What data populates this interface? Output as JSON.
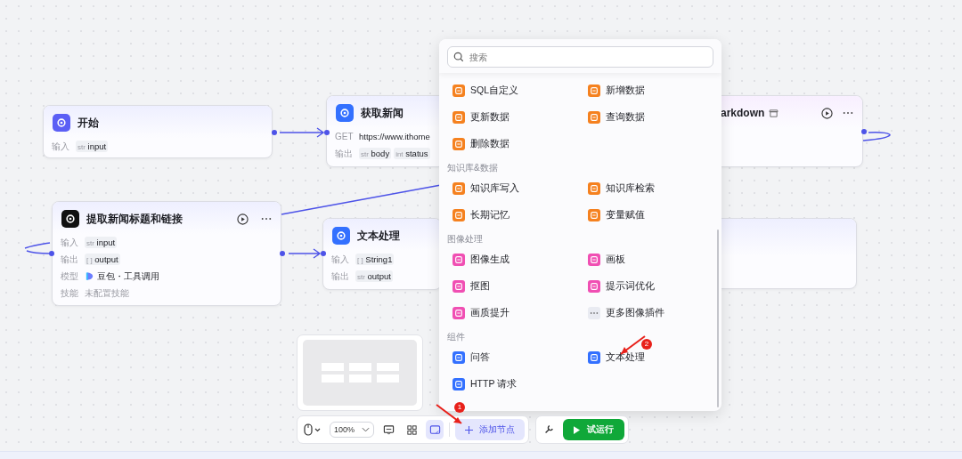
{
  "nodes": [
    {
      "title": "开始",
      "color": "#5b5ff5",
      "has_actions": false,
      "rows": [
        {
          "label": "输入",
          "kind": "tags",
          "tags": [
            {
              "type": "str",
              "name": "input"
            }
          ]
        }
      ]
    },
    {
      "title": "获取新闻",
      "color": "#3370ff",
      "has_actions": false,
      "rows": [
        {
          "label": "GET",
          "kind": "text",
          "value": "https://www.ithome"
        },
        {
          "label": "输出",
          "kind": "tags",
          "tags": [
            {
              "type": "str",
              "name": "body"
            },
            {
              "type": "int",
              "name": "status"
            }
          ]
        }
      ]
    },
    {
      "title": "arkdown",
      "has_actions": true
    },
    {
      "title": "提取新闻标题和链接",
      "color": "#111111",
      "has_actions": true,
      "rows": [
        {
          "label": "输入",
          "kind": "tags",
          "tags": [
            {
              "type": "str",
              "name": "input"
            }
          ]
        },
        {
          "label": "输出",
          "kind": "tags",
          "tags": [
            {
              "type": "[ ]",
              "name": "output"
            }
          ]
        },
        {
          "label": "模型",
          "kind": "model",
          "value": "豆包・工具调用"
        },
        {
          "label": "技能",
          "kind": "muted",
          "value": "未配置技能"
        }
      ]
    },
    {
      "title": "文本处理",
      "color": "#3370ff",
      "has_actions": false,
      "rows": [
        {
          "label": "输入",
          "kind": "tags",
          "tags": [
            {
              "type": "[ ]",
              "name": "String1"
            }
          ]
        },
        {
          "label": "输出",
          "kind": "tags",
          "tags": [
            {
              "type": "str",
              "name": "output"
            }
          ]
        }
      ]
    }
  ],
  "node_menu": {
    "search": {
      "placeholder": "搜索"
    },
    "sections": [
      {
        "items": [
          {
            "label": "SQL自定义",
            "kind": "node",
            "color": "#f5811f"
          },
          {
            "label": "新增数据",
            "kind": "node",
            "color": "#f5811f"
          },
          {
            "label": "更新数据",
            "kind": "node",
            "color": "#f5811f"
          },
          {
            "label": "查询数据",
            "kind": "node",
            "color": "#f5811f"
          },
          {
            "label": "删除数据",
            "kind": "node",
            "color": "#f5811f"
          }
        ]
      },
      {
        "title": "知识库&数据",
        "items": [
          {
            "label": "知识库写入",
            "kind": "node",
            "color": "#f5811f"
          },
          {
            "label": "知识库检索",
            "kind": "node",
            "color": "#f5811f"
          },
          {
            "label": "长期记忆",
            "kind": "node",
            "color": "#f5811f"
          },
          {
            "label": "变量赋值",
            "kind": "node",
            "color": "#f5811f"
          }
        ]
      },
      {
        "title": "图像处理",
        "items": [
          {
            "label": "图像生成",
            "kind": "node",
            "color": "#f04fb3"
          },
          {
            "label": "画板",
            "kind": "node",
            "color": "#f04fb3"
          },
          {
            "label": "抠图",
            "kind": "node",
            "color": "#f04fb3"
          },
          {
            "label": "提示词优化",
            "kind": "node",
            "color": "#f04fb3"
          },
          {
            "label": "画质提升",
            "kind": "node",
            "color": "#f04fb3"
          },
          {
            "label": "更多图像插件",
            "kind": "more",
            "color": "#e9ebf2"
          }
        ]
      },
      {
        "title": "组件",
        "items": [
          {
            "label": "问答",
            "kind": "node",
            "color": "#3370ff"
          },
          {
            "label": "文本处理",
            "kind": "node",
            "color": "#3370ff"
          },
          {
            "label": "HTTP 请求",
            "kind": "node",
            "color": "#3370ff"
          }
        ]
      }
    ]
  },
  "annotations": [
    {
      "number": "1"
    },
    {
      "number": "2"
    }
  ],
  "toolbar": {
    "zoom": "100%",
    "minimap_on": true,
    "add_node": "添加节点",
    "run": "试运行"
  }
}
